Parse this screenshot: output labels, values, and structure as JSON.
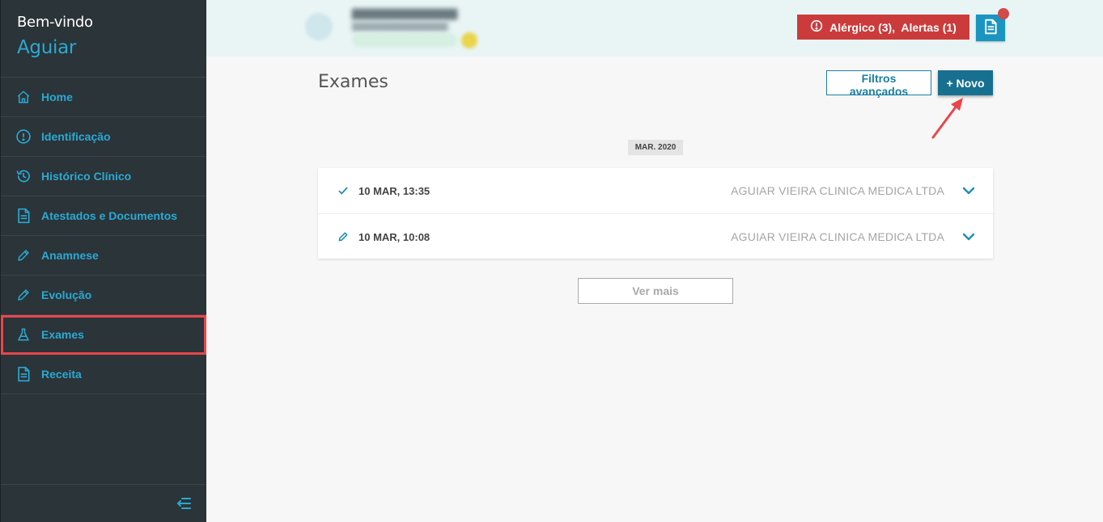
{
  "sidebar": {
    "welcome": "Bem-vindo",
    "username": "Aguiar",
    "items": [
      {
        "label": "Home",
        "icon": "home-icon"
      },
      {
        "label": "Identificação",
        "icon": "info-icon"
      },
      {
        "label": "Histórico Clínico",
        "icon": "history-icon"
      },
      {
        "label": "Atestados e Documentos",
        "icon": "document-icon"
      },
      {
        "label": "Anamnese",
        "icon": "pencil-icon"
      },
      {
        "label": "Evolução",
        "icon": "pencil-icon"
      },
      {
        "label": "Exames",
        "icon": "flask-icon",
        "active": true
      },
      {
        "label": "Receita",
        "icon": "document-icon"
      }
    ],
    "collapse_icon": "collapse-menu-icon"
  },
  "header": {
    "alert_label": "Alérgico (3),  Alertas (1)",
    "alert_color": "#cc3b3b",
    "accent_color": "#1a95c2"
  },
  "main": {
    "title": "Exames",
    "filters_button": "Filtros avançados",
    "new_button": "+ Novo",
    "date_group": "MAR. 2020",
    "exams": [
      {
        "date": "10 MAR, 13:35",
        "clinic": "AGUIAR VIEIRA CLINICA MEDICA LTDA",
        "status_icon": "check-icon"
      },
      {
        "date": "10 MAR, 10:08",
        "clinic": "AGUIAR VIEIRA CLINICA MEDICA LTDA",
        "status_icon": "pencil-icon"
      }
    ],
    "load_more": "Ver mais"
  }
}
